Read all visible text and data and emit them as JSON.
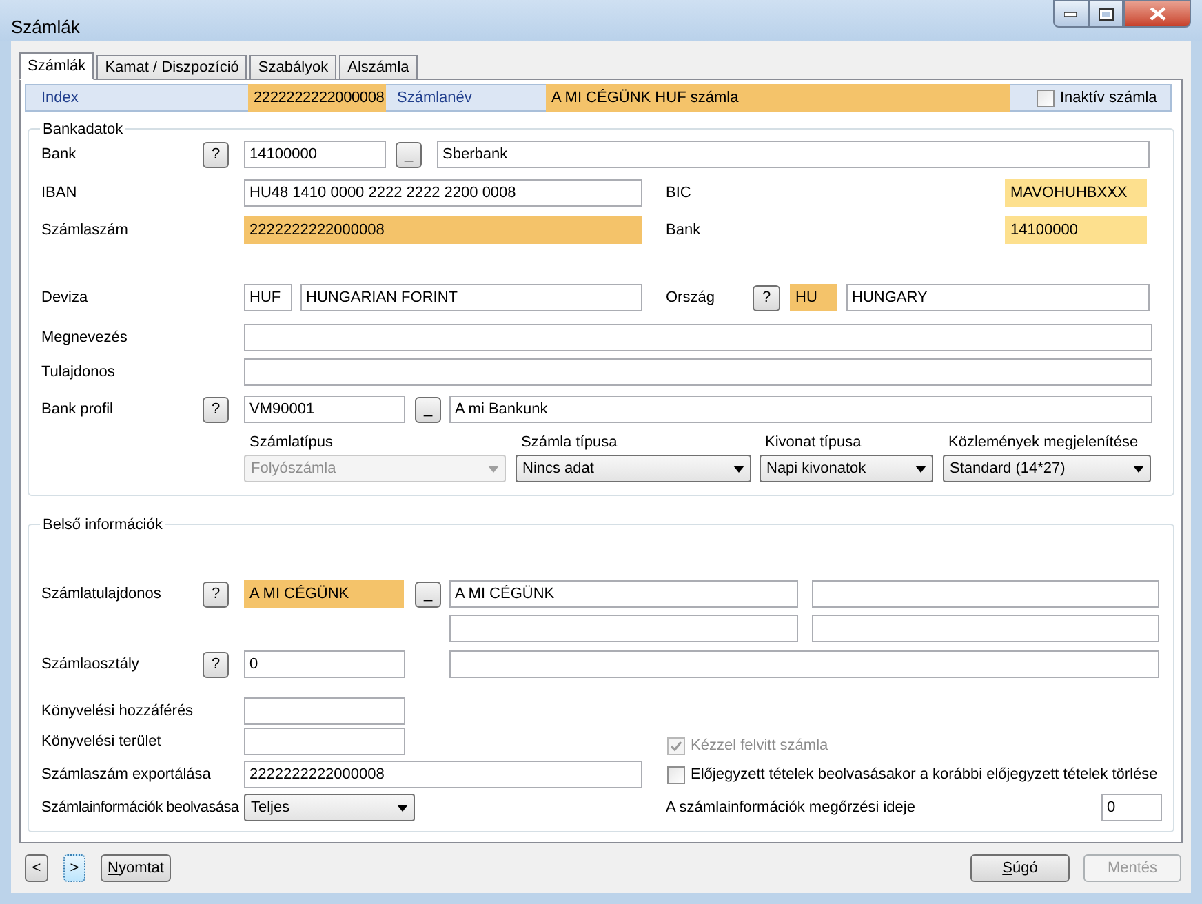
{
  "window": {
    "title": "Számlák"
  },
  "tabs": [
    {
      "label": "Számlák",
      "selected": true
    },
    {
      "label": "Kamat / Diszpozíció",
      "selected": false
    },
    {
      "label": "Szabályok",
      "selected": false
    },
    {
      "label": "Alszámla",
      "selected": false
    }
  ],
  "header": {
    "index_label": "Index",
    "index": {
      "value": "2222222222000008",
      "highlighted": true
    },
    "name_label": "Számlanév",
    "name": {
      "value": "A MI CÉGÜNK HUF számla",
      "highlighted": true
    },
    "inactive": {
      "label": "Inaktív számla",
      "checked": false,
      "disabled": false
    }
  },
  "bank_data": {
    "title": "Bankadatok",
    "bank": {
      "label": "Bank",
      "help": "?",
      "code": "14100000",
      "browse": "_",
      "name": "Sberbank"
    },
    "iban": {
      "label": "IBAN",
      "value": "HU48 1410 0000 2222 2222 2200 0008"
    },
    "bic": {
      "label": "BIC",
      "value": "MAVOHUHBXXX",
      "highlighted": true,
      "pale": true
    },
    "account_number": {
      "label": "Számlaszám",
      "value": "2222222222000008",
      "highlighted": true
    },
    "bank_code": {
      "label": "Bank",
      "value": "14100000",
      "highlighted": true,
      "pale": true
    },
    "currency": {
      "label": "Deviza",
      "code": "HUF",
      "name": "HUNGARIAN FORINT"
    },
    "country": {
      "label": "Ország",
      "help": "?",
      "code": "HU",
      "highlighted": true,
      "name": "HUNGARY"
    },
    "designation": {
      "label": "Megnevezés"
    },
    "owner": {
      "label": "Tulajdonos"
    },
    "bank_profile": {
      "label": "Bank profil",
      "help": "?",
      "code": "VM90001",
      "browse": "_",
      "name": "A mi Bankunk"
    },
    "dropdowns": [
      {
        "label": "Számlatípus",
        "value": "Folyószámla",
        "disabled": true
      },
      {
        "label": "Számla típusa",
        "value": "Nincs adat",
        "disabled": false
      },
      {
        "label": "Kivonat típusa",
        "value": "Napi kivonatok",
        "disabled": false
      },
      {
        "label": "Közlemények megjelenítése",
        "value": "Standard (14*27)",
        "disabled": false
      }
    ]
  },
  "internal": {
    "title": "Belső információk",
    "account_owner": {
      "label": "Számlatulajdonos",
      "help": "?",
      "code": "A MI CÉGÜNK",
      "highlighted": true,
      "browse": "_",
      "name": "A MI CÉGÜNK"
    },
    "account_class": {
      "label": "Számlaosztály",
      "help": "?",
      "code": "0"
    },
    "accounting_access": {
      "label": "Könyvelési hozzáférés"
    },
    "accounting_area": {
      "label": "Könyvelési terület"
    },
    "export": {
      "label": "Számlaszám exportálása",
      "value": "2222222222000008"
    },
    "import": {
      "label": "Számlainformációk beolvasása",
      "value": "Teljes",
      "disabled": false
    },
    "checkboxes": [
      {
        "label": "Kézzel felvitt számla",
        "checked": true,
        "disabled": true
      },
      {
        "label": "Előjegyzett tételek beolvasásakor a korábbi előjegyzett tételek törlése",
        "checked": false,
        "disabled": false
      }
    ],
    "retention": {
      "label": "A számlainformációk megőrzési ideje",
      "value": "0"
    }
  },
  "footer": [
    {
      "label": "<",
      "focused": false,
      "disabled": false,
      "accelerator": false
    },
    {
      "label": ">",
      "focused": true,
      "disabled": false,
      "accelerator": false
    },
    {
      "label": "Nyomtat",
      "focused": false,
      "disabled": false,
      "accelerator": true
    },
    {
      "label": "Súgó",
      "focused": false,
      "disabled": false,
      "accelerator": true
    },
    {
      "label": "Mentés",
      "focused": false,
      "disabled": true,
      "accelerator": false
    }
  ]
}
